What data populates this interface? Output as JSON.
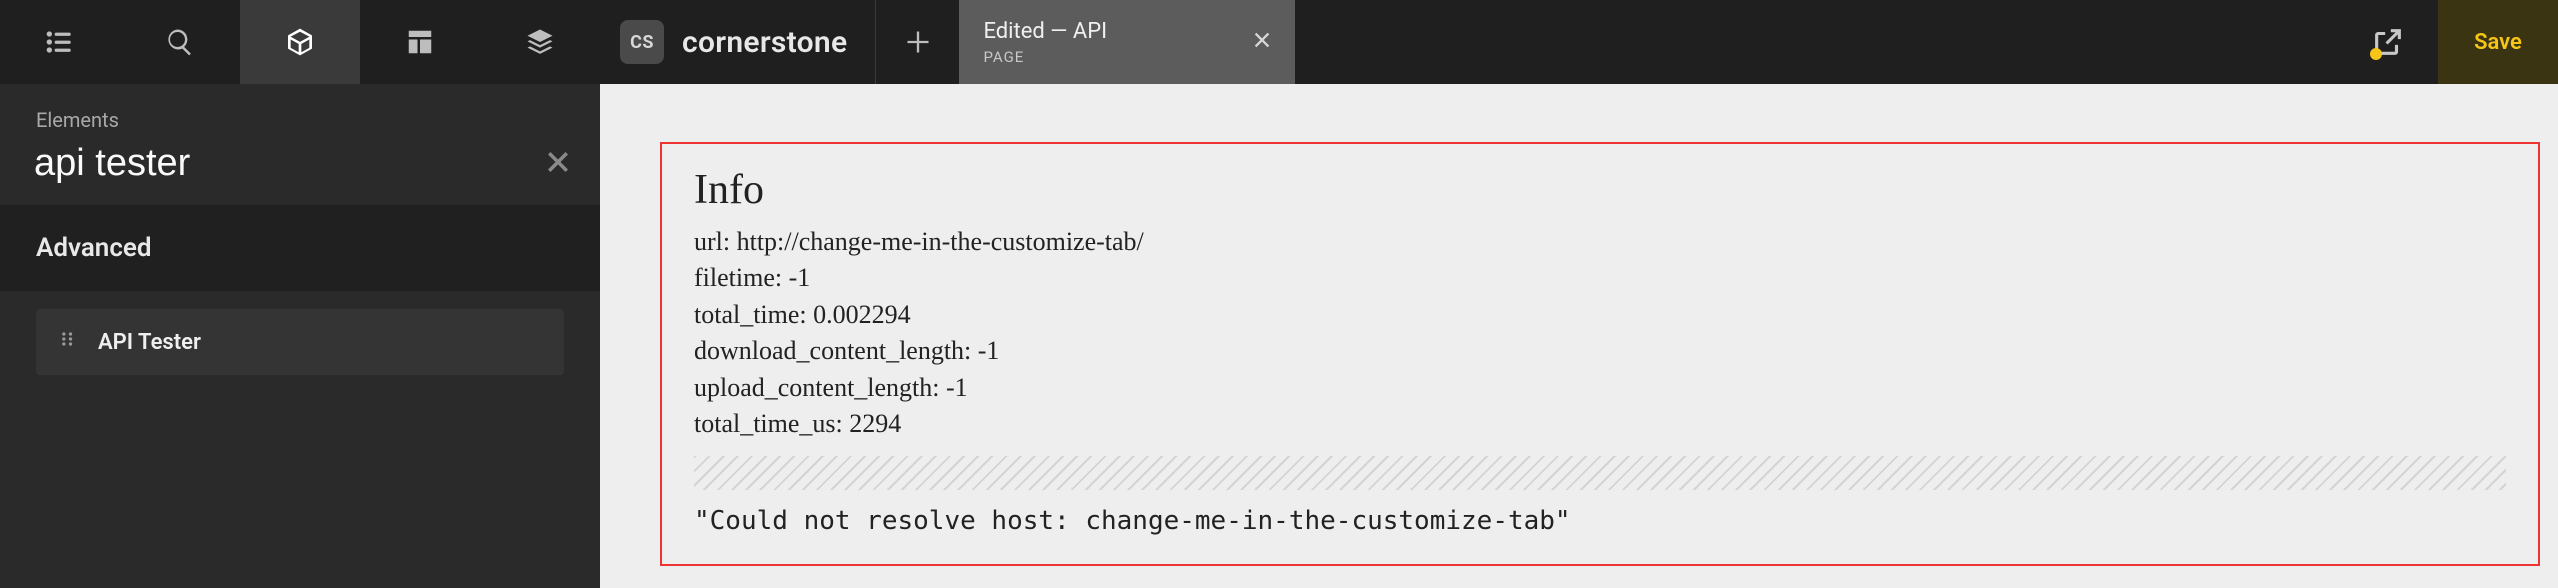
{
  "topbar": {
    "brand_badge": "CS",
    "brand_name": "cornerstone",
    "tab": {
      "title": "Edited — API",
      "subtitle": "PAGE"
    },
    "save_label": "Save"
  },
  "sidebar": {
    "label": "Elements",
    "search_value": "api tester",
    "section_header": "Advanced",
    "items": [
      {
        "label": "API Tester"
      }
    ]
  },
  "result": {
    "title": "Info",
    "lines": [
      "url: http://change-me-in-the-customize-tab/",
      "filetime: -1",
      "total_time: 0.002294",
      "download_content_length: -1",
      "upload_content_length: -1",
      "total_time_us: 2294"
    ],
    "error": "\"Could not resolve host: change-me-in-the-customize-tab\""
  }
}
